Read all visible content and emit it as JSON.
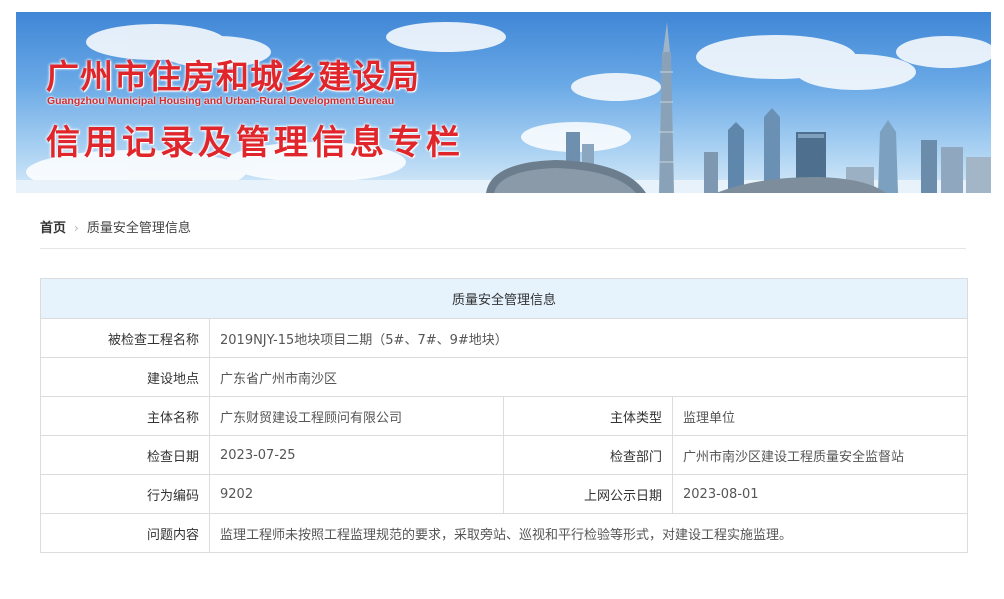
{
  "banner": {
    "title": "广州市住房和城乡建设局",
    "subtitle": "Guangzhou Municipal Housing and Urban-Rural Development Bureau",
    "column": "信用记录及管理信息专栏"
  },
  "breadcrumb": {
    "home": "首页",
    "separator": "›",
    "current": "质量安全管理信息"
  },
  "table": {
    "header": "质量安全管理信息",
    "project_name_label": "被检查工程名称",
    "project_name": "2019NJY-15地块项目二期（5#、7#、9#地块）",
    "location_label": "建设地点",
    "location": "广东省广州市南沙区",
    "entity_name_label": "主体名称",
    "entity_name": "广东财贸建设工程顾问有限公司",
    "entity_type_label": "主体类型",
    "entity_type": "监理单位",
    "inspection_date_label": "检查日期",
    "inspection_date": "2023-07-25",
    "inspection_dept_label": "检查部门",
    "inspection_dept": "广州市南沙区建设工程质量安全监督站",
    "behavior_code_label": "行为编码",
    "behavior_code": "9202",
    "publish_date_label": "上网公示日期",
    "publish_date": "2023-08-01",
    "issue_label": "问题内容",
    "issue": "监理工程师未按照工程监理规范的要求，采取旁站、巡视和平行检验等形式，对建设工程实施监理。"
  },
  "colors": {
    "title_red": "#e0262b",
    "header_bg": "#e6f3fd",
    "border": "#dcdcdc"
  }
}
